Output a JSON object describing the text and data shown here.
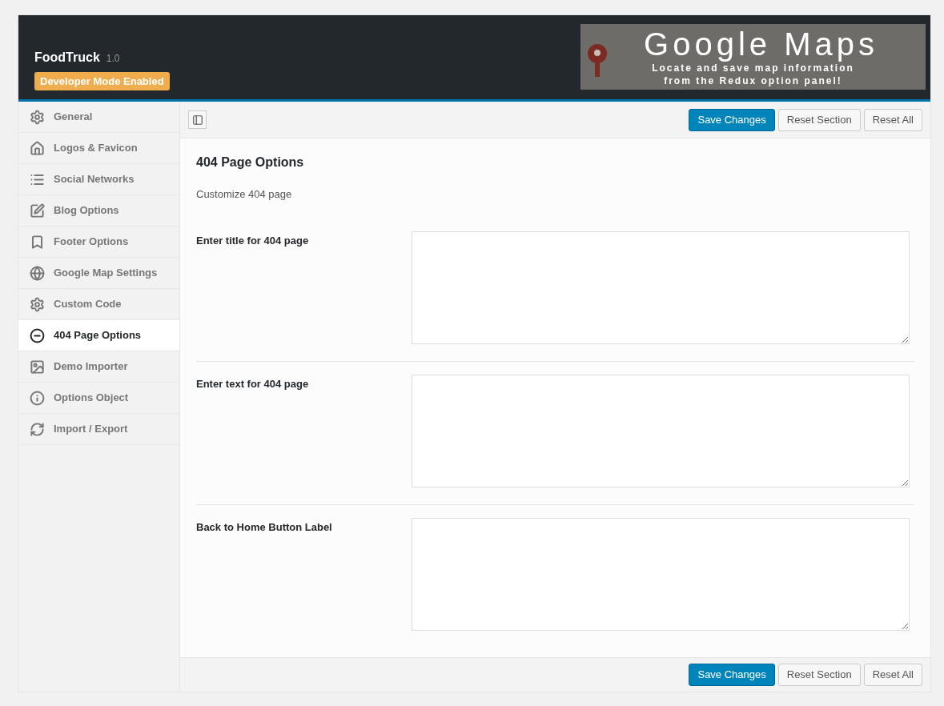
{
  "header": {
    "title": "FoodTruck",
    "version": "1.0",
    "badge": "Developer Mode Enabled",
    "banner": {
      "heading": "Google Maps",
      "lines": [
        "Locate and save map information",
        "from the Redux option panel!"
      ]
    }
  },
  "sidebar": {
    "items": [
      {
        "label": "General",
        "selected": false
      },
      {
        "label": "Logos & Favicon",
        "selected": false
      },
      {
        "label": "Social Networks",
        "selected": false
      },
      {
        "label": "Blog Options",
        "selected": false
      },
      {
        "label": "Footer Options",
        "selected": false
      },
      {
        "label": "Google Map Settings",
        "selected": false
      },
      {
        "label": "Custom Code",
        "selected": false
      },
      {
        "label": "404 Page Options",
        "selected": true
      },
      {
        "label": "Demo Importer",
        "selected": false
      },
      {
        "label": "Options Object",
        "selected": false
      },
      {
        "label": "Import / Export",
        "selected": false
      }
    ]
  },
  "toolbar": {
    "buttons": [
      {
        "label": "Save Changes",
        "kind": "primary"
      },
      {
        "label": "Reset Section",
        "kind": "secondary"
      },
      {
        "label": "Reset All",
        "kind": "secondary"
      }
    ]
  },
  "section": {
    "title": "404 Page Options",
    "description": "Customize 404 page",
    "fields": [
      {
        "label": "Enter title for 404 page"
      },
      {
        "label": "Enter text for 404 page"
      },
      {
        "label": "Back to Home Button Label"
      }
    ]
  },
  "footer": {
    "buttons": [
      {
        "label": "Save Changes",
        "kind": "primary"
      },
      {
        "label": "Reset Section",
        "kind": "secondary"
      },
      {
        "label": "Reset All",
        "kind": "secondary"
      }
    ]
  }
}
